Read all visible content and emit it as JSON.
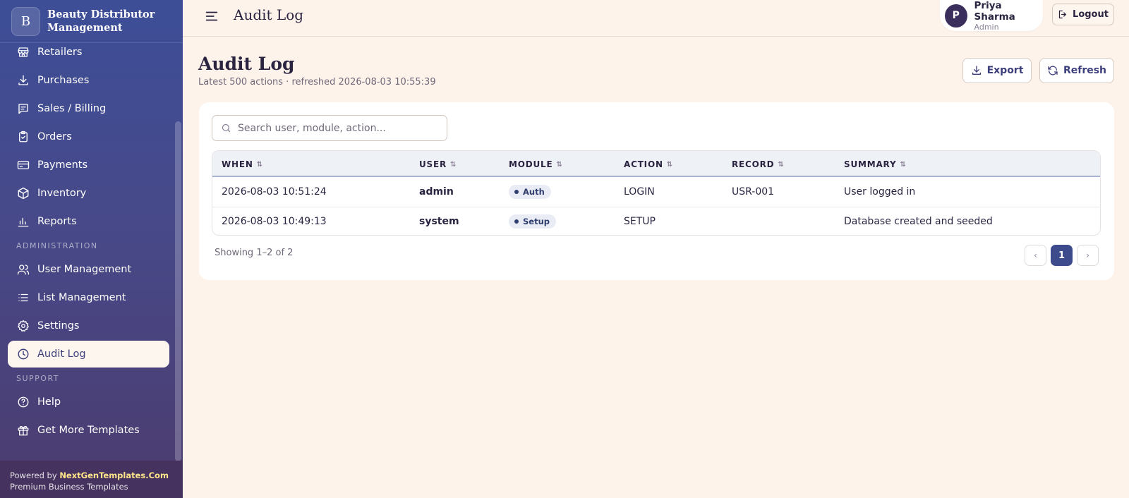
{
  "brand": {
    "logo_letter": "B",
    "name_line1": "Beauty Distributor",
    "name_line2": "Management"
  },
  "sidebar": {
    "items": [
      {
        "label": "Retailers",
        "icon": "store-icon"
      },
      {
        "label": "Purchases",
        "icon": "download-icon"
      },
      {
        "label": "Sales / Billing",
        "icon": "receipt-icon"
      },
      {
        "label": "Orders",
        "icon": "clipboard-icon"
      },
      {
        "label": "Payments",
        "icon": "credit-card-icon"
      },
      {
        "label": "Inventory",
        "icon": "box-icon"
      },
      {
        "label": "Reports",
        "icon": "bar-chart-icon"
      }
    ],
    "section_admin": "ADMINISTRATION",
    "admin_items": [
      {
        "label": "User Management",
        "icon": "users-icon"
      },
      {
        "label": "List Management",
        "icon": "list-icon"
      },
      {
        "label": "Settings",
        "icon": "gear-icon"
      },
      {
        "label": "Audit Log",
        "icon": "clock-icon",
        "active": true
      }
    ],
    "section_support": "SUPPORT",
    "support_items": [
      {
        "label": "Help",
        "icon": "help-circle-icon"
      },
      {
        "label": "Get More Templates",
        "icon": "gift-icon"
      }
    ],
    "powered_prefix": "Powered by ",
    "powered_brand": "NextGenTemplates.Com",
    "powered_tagline": "Premium Business Templates"
  },
  "topbar": {
    "title": "Audit Log",
    "user": {
      "initial": "P",
      "name": "Priya Sharma",
      "role": "Admin"
    },
    "logout_label": "Logout"
  },
  "page": {
    "title": "Audit Log",
    "subtitle": "Latest 500 actions · refreshed 2026-08-03 10:55:39",
    "export_label": "Export",
    "refresh_label": "Refresh"
  },
  "search": {
    "placeholder": "Search user, module, action...",
    "value": ""
  },
  "table": {
    "sort_glyph": "⇅",
    "headers": [
      "WHEN",
      "USER",
      "MODULE",
      "ACTION",
      "RECORD",
      "SUMMARY"
    ],
    "rows": [
      {
        "when": "2026-08-03 10:51:24",
        "user": "admin",
        "module": "Auth",
        "action": "LOGIN",
        "record": "USR-001",
        "summary": "User logged in"
      },
      {
        "when": "2026-08-03 10:49:13",
        "user": "system",
        "module": "Setup",
        "action": "SETUP",
        "record": "",
        "summary": "Database created and seeded"
      }
    ]
  },
  "pagination": {
    "showing": "Showing 1–2 of 2",
    "prev": "‹",
    "current": "1",
    "next": "›"
  },
  "colors": {
    "sidebar_top": "#3d4e97",
    "sidebar_bottom": "#4c3c6f",
    "page_bg": "#fdf3ea",
    "accent": "#3d4a8c",
    "powered_brand": "#ffe58a"
  }
}
